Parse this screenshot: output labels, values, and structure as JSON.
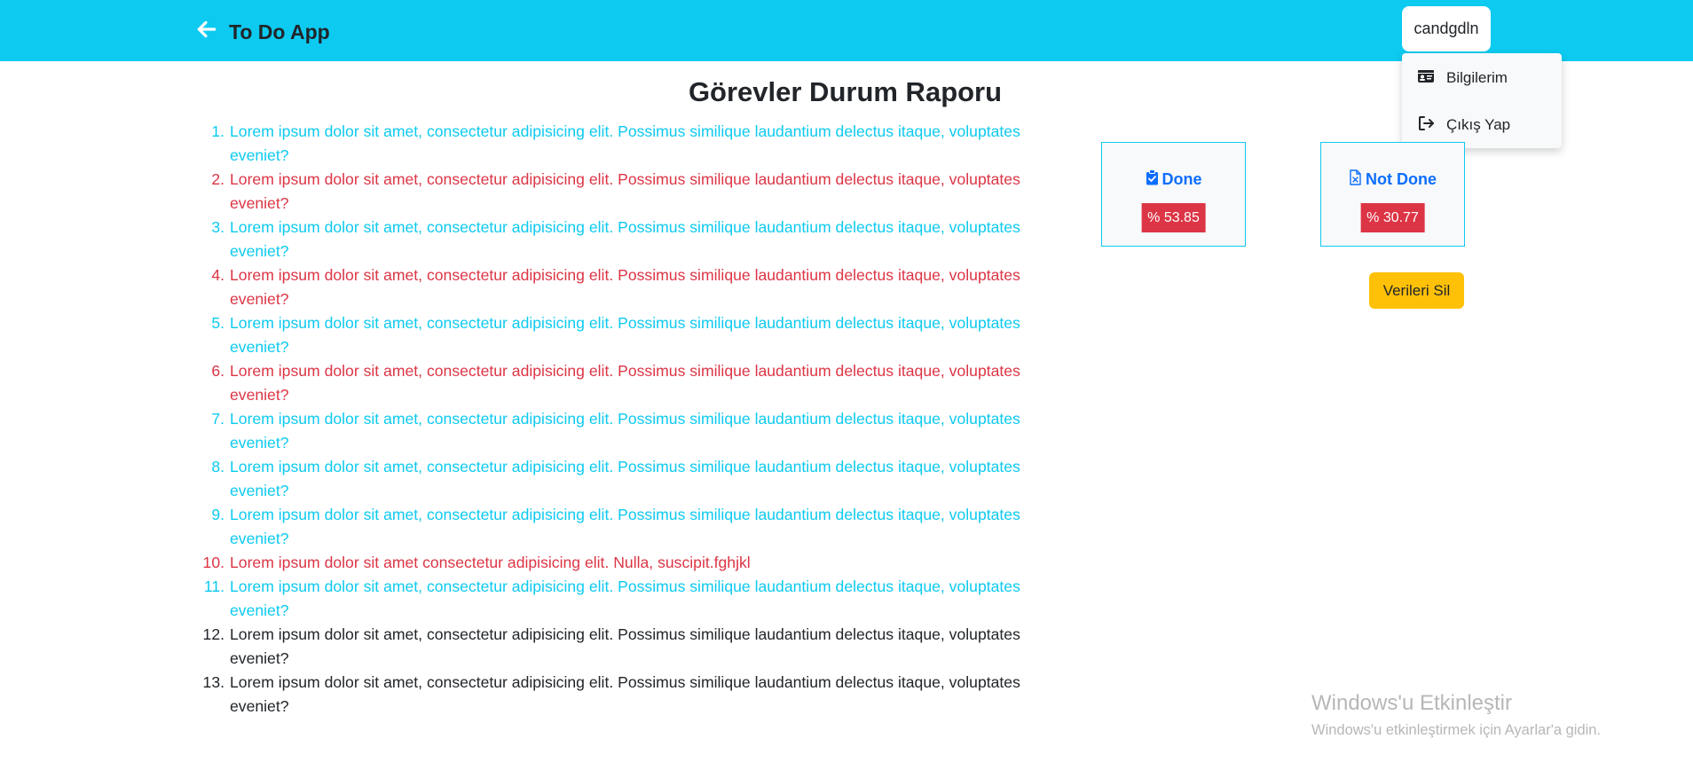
{
  "navbar": {
    "brand": "To Do App",
    "user": "candgdln",
    "menu": [
      {
        "label": "Bilgilerim",
        "icon": "id-card-icon"
      },
      {
        "label": "Çıkış Yap",
        "icon": "logout-icon"
      }
    ],
    "accent_color": "#0dcaf0"
  },
  "main": {
    "title": "Görevler Durum Raporu",
    "tasks": [
      {
        "num": "1.",
        "text": "Lorem ipsum dolor sit amet, consectetur adipisicing elit. Possimus similique laudantium delectus itaque, voluptates eveniet?",
        "status": "done"
      },
      {
        "num": "2.",
        "text": "Lorem ipsum dolor sit amet, consectetur adipisicing elit. Possimus similique laudantium delectus itaque, voluptates eveniet?",
        "status": "not-done"
      },
      {
        "num": "3.",
        "text": "Lorem ipsum dolor sit amet, consectetur adipisicing elit. Possimus similique laudantium delectus itaque, voluptates eveniet?",
        "status": "done"
      },
      {
        "num": "4.",
        "text": "Lorem ipsum dolor sit amet, consectetur adipisicing elit. Possimus similique laudantium delectus itaque, voluptates eveniet?",
        "status": "not-done"
      },
      {
        "num": "5.",
        "text": "Lorem ipsum dolor sit amet, consectetur adipisicing elit. Possimus similique laudantium delectus itaque, voluptates eveniet?",
        "status": "done"
      },
      {
        "num": "6.",
        "text": "Lorem ipsum dolor sit amet, consectetur adipisicing elit. Possimus similique laudantium delectus itaque, voluptates eveniet?",
        "status": "not-done"
      },
      {
        "num": "7.",
        "text": "Lorem ipsum dolor sit amet, consectetur adipisicing elit. Possimus similique laudantium delectus itaque, voluptates eveniet?",
        "status": "done"
      },
      {
        "num": "8.",
        "text": "Lorem ipsum dolor sit amet, consectetur adipisicing elit. Possimus similique laudantium delectus itaque, voluptates eveniet?",
        "status": "done"
      },
      {
        "num": "9.",
        "text": "Lorem ipsum dolor sit amet, consectetur adipisicing elit. Possimus similique laudantium delectus itaque, voluptates eveniet?",
        "status": "done"
      },
      {
        "num": "10.",
        "text": "Lorem ipsum dolor sit amet consectetur adipisicing elit. Nulla, suscipit.fghjkl",
        "status": "not-done"
      },
      {
        "num": "11.",
        "text": "Lorem ipsum dolor sit amet, consectetur adipisicing elit. Possimus similique laudantium delectus itaque, voluptates eveniet?",
        "status": "done"
      },
      {
        "num": "12.",
        "text": "Lorem ipsum dolor sit amet, consectetur adipisicing elit. Possimus similique laudantium delectus itaque, voluptates eveniet?",
        "status": "none"
      },
      {
        "num": "13.",
        "text": "Lorem ipsum dolor sit amet, consectetur adipisicing elit. Possimus similique laudantium delectus itaque, voluptates eveniet?",
        "status": "none"
      }
    ],
    "status_colors": {
      "done": "#0dcaf0",
      "not-done": "#dc3545",
      "none": "#212529"
    }
  },
  "stats": {
    "done": {
      "label": "Done",
      "value": "% 53.85",
      "icon": "clipboard-check-icon"
    },
    "not_done": {
      "label": "Not Done",
      "value": "% 30.77",
      "icon": "file-x-icon"
    },
    "delete_label": "Verileri Sil"
  },
  "watermark": {
    "title": "Windows'u Etkinleştir",
    "subtitle": "Windows'u etkinleştirmek için Ayarlar'a gidin."
  }
}
